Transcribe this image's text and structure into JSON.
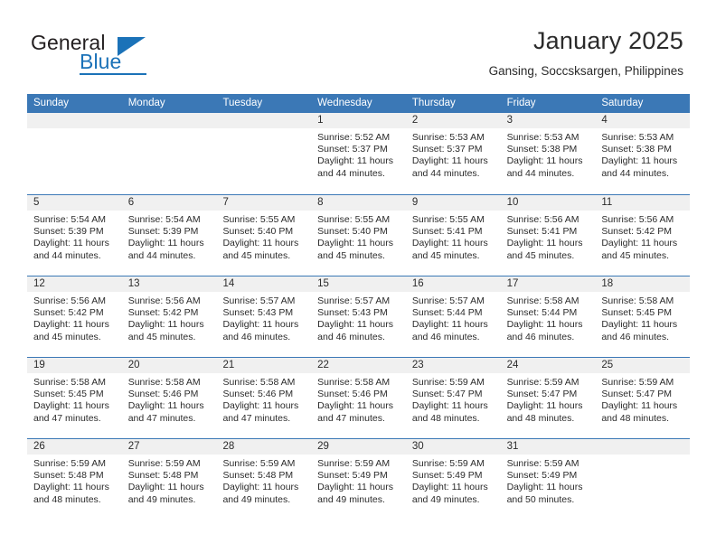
{
  "brand": {
    "name_part1": "General",
    "name_part2": "Blue",
    "accent_color": "#1b72b8"
  },
  "header": {
    "title": "January 2025",
    "subtitle": "Gansing, Soccsksargen, Philippines"
  },
  "calendar": {
    "header_color": "#3b78b6",
    "date_band_color": "#f0f0f0",
    "weekdays": [
      "Sunday",
      "Monday",
      "Tuesday",
      "Wednesday",
      "Thursday",
      "Friday",
      "Saturday"
    ],
    "weeks": [
      [
        {
          "date": "",
          "lines": []
        },
        {
          "date": "",
          "lines": []
        },
        {
          "date": "",
          "lines": []
        },
        {
          "date": "1",
          "lines": [
            "Sunrise: 5:52 AM",
            "Sunset: 5:37 PM",
            "Daylight: 11 hours",
            "and 44 minutes."
          ]
        },
        {
          "date": "2",
          "lines": [
            "Sunrise: 5:53 AM",
            "Sunset: 5:37 PM",
            "Daylight: 11 hours",
            "and 44 minutes."
          ]
        },
        {
          "date": "3",
          "lines": [
            "Sunrise: 5:53 AM",
            "Sunset: 5:38 PM",
            "Daylight: 11 hours",
            "and 44 minutes."
          ]
        },
        {
          "date": "4",
          "lines": [
            "Sunrise: 5:53 AM",
            "Sunset: 5:38 PM",
            "Daylight: 11 hours",
            "and 44 minutes."
          ]
        }
      ],
      [
        {
          "date": "5",
          "lines": [
            "Sunrise: 5:54 AM",
            "Sunset: 5:39 PM",
            "Daylight: 11 hours",
            "and 44 minutes."
          ]
        },
        {
          "date": "6",
          "lines": [
            "Sunrise: 5:54 AM",
            "Sunset: 5:39 PM",
            "Daylight: 11 hours",
            "and 44 minutes."
          ]
        },
        {
          "date": "7",
          "lines": [
            "Sunrise: 5:55 AM",
            "Sunset: 5:40 PM",
            "Daylight: 11 hours",
            "and 45 minutes."
          ]
        },
        {
          "date": "8",
          "lines": [
            "Sunrise: 5:55 AM",
            "Sunset: 5:40 PM",
            "Daylight: 11 hours",
            "and 45 minutes."
          ]
        },
        {
          "date": "9",
          "lines": [
            "Sunrise: 5:55 AM",
            "Sunset: 5:41 PM",
            "Daylight: 11 hours",
            "and 45 minutes."
          ]
        },
        {
          "date": "10",
          "lines": [
            "Sunrise: 5:56 AM",
            "Sunset: 5:41 PM",
            "Daylight: 11 hours",
            "and 45 minutes."
          ]
        },
        {
          "date": "11",
          "lines": [
            "Sunrise: 5:56 AM",
            "Sunset: 5:42 PM",
            "Daylight: 11 hours",
            "and 45 minutes."
          ]
        }
      ],
      [
        {
          "date": "12",
          "lines": [
            "Sunrise: 5:56 AM",
            "Sunset: 5:42 PM",
            "Daylight: 11 hours",
            "and 45 minutes."
          ]
        },
        {
          "date": "13",
          "lines": [
            "Sunrise: 5:56 AM",
            "Sunset: 5:42 PM",
            "Daylight: 11 hours",
            "and 45 minutes."
          ]
        },
        {
          "date": "14",
          "lines": [
            "Sunrise: 5:57 AM",
            "Sunset: 5:43 PM",
            "Daylight: 11 hours",
            "and 46 minutes."
          ]
        },
        {
          "date": "15",
          "lines": [
            "Sunrise: 5:57 AM",
            "Sunset: 5:43 PM",
            "Daylight: 11 hours",
            "and 46 minutes."
          ]
        },
        {
          "date": "16",
          "lines": [
            "Sunrise: 5:57 AM",
            "Sunset: 5:44 PM",
            "Daylight: 11 hours",
            "and 46 minutes."
          ]
        },
        {
          "date": "17",
          "lines": [
            "Sunrise: 5:58 AM",
            "Sunset: 5:44 PM",
            "Daylight: 11 hours",
            "and 46 minutes."
          ]
        },
        {
          "date": "18",
          "lines": [
            "Sunrise: 5:58 AM",
            "Sunset: 5:45 PM",
            "Daylight: 11 hours",
            "and 46 minutes."
          ]
        }
      ],
      [
        {
          "date": "19",
          "lines": [
            "Sunrise: 5:58 AM",
            "Sunset: 5:45 PM",
            "Daylight: 11 hours",
            "and 47 minutes."
          ]
        },
        {
          "date": "20",
          "lines": [
            "Sunrise: 5:58 AM",
            "Sunset: 5:46 PM",
            "Daylight: 11 hours",
            "and 47 minutes."
          ]
        },
        {
          "date": "21",
          "lines": [
            "Sunrise: 5:58 AM",
            "Sunset: 5:46 PM",
            "Daylight: 11 hours",
            "and 47 minutes."
          ]
        },
        {
          "date": "22",
          "lines": [
            "Sunrise: 5:58 AM",
            "Sunset: 5:46 PM",
            "Daylight: 11 hours",
            "and 47 minutes."
          ]
        },
        {
          "date": "23",
          "lines": [
            "Sunrise: 5:59 AM",
            "Sunset: 5:47 PM",
            "Daylight: 11 hours",
            "and 48 minutes."
          ]
        },
        {
          "date": "24",
          "lines": [
            "Sunrise: 5:59 AM",
            "Sunset: 5:47 PM",
            "Daylight: 11 hours",
            "and 48 minutes."
          ]
        },
        {
          "date": "25",
          "lines": [
            "Sunrise: 5:59 AM",
            "Sunset: 5:47 PM",
            "Daylight: 11 hours",
            "and 48 minutes."
          ]
        }
      ],
      [
        {
          "date": "26",
          "lines": [
            "Sunrise: 5:59 AM",
            "Sunset: 5:48 PM",
            "Daylight: 11 hours",
            "and 48 minutes."
          ]
        },
        {
          "date": "27",
          "lines": [
            "Sunrise: 5:59 AM",
            "Sunset: 5:48 PM",
            "Daylight: 11 hours",
            "and 49 minutes."
          ]
        },
        {
          "date": "28",
          "lines": [
            "Sunrise: 5:59 AM",
            "Sunset: 5:48 PM",
            "Daylight: 11 hours",
            "and 49 minutes."
          ]
        },
        {
          "date": "29",
          "lines": [
            "Sunrise: 5:59 AM",
            "Sunset: 5:49 PM",
            "Daylight: 11 hours",
            "and 49 minutes."
          ]
        },
        {
          "date": "30",
          "lines": [
            "Sunrise: 5:59 AM",
            "Sunset: 5:49 PM",
            "Daylight: 11 hours",
            "and 49 minutes."
          ]
        },
        {
          "date": "31",
          "lines": [
            "Sunrise: 5:59 AM",
            "Sunset: 5:49 PM",
            "Daylight: 11 hours",
            "and 50 minutes."
          ]
        },
        {
          "date": "",
          "lines": []
        }
      ]
    ]
  }
}
